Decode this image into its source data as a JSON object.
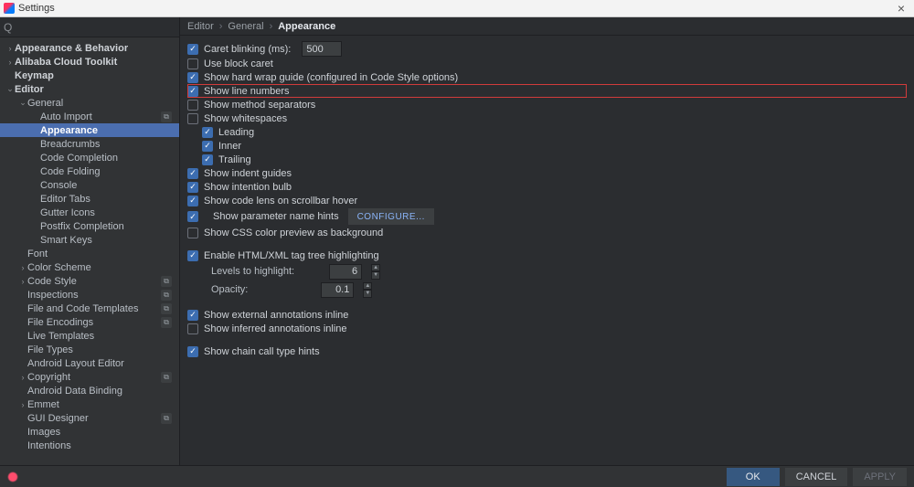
{
  "window": {
    "title": "Settings"
  },
  "search": {
    "placeholder": "",
    "value": ""
  },
  "sidebar": {
    "items": [
      {
        "depth": 0,
        "label": "Appearance & Behavior",
        "arrow": "›",
        "bold": true,
        "scope": false
      },
      {
        "depth": 0,
        "label": "Alibaba Cloud Toolkit",
        "arrow": "›",
        "bold": true,
        "scope": false
      },
      {
        "depth": 0,
        "label": "Keymap",
        "arrow": "",
        "bold": true,
        "scope": false
      },
      {
        "depth": 0,
        "label": "Editor",
        "arrow": "⌄",
        "bold": true,
        "scope": false
      },
      {
        "depth": 1,
        "label": "General",
        "arrow": "⌄",
        "bold": false,
        "scope": false
      },
      {
        "depth": 2,
        "label": "Auto Import",
        "arrow": "",
        "bold": false,
        "scope": true
      },
      {
        "depth": 2,
        "label": "Appearance",
        "arrow": "",
        "bold": false,
        "scope": false,
        "selected": true
      },
      {
        "depth": 2,
        "label": "Breadcrumbs",
        "arrow": "",
        "bold": false,
        "scope": false
      },
      {
        "depth": 2,
        "label": "Code Completion",
        "arrow": "",
        "bold": false,
        "scope": false
      },
      {
        "depth": 2,
        "label": "Code Folding",
        "arrow": "",
        "bold": false,
        "scope": false
      },
      {
        "depth": 2,
        "label": "Console",
        "arrow": "",
        "bold": false,
        "scope": false
      },
      {
        "depth": 2,
        "label": "Editor Tabs",
        "arrow": "",
        "bold": false,
        "scope": false
      },
      {
        "depth": 2,
        "label": "Gutter Icons",
        "arrow": "",
        "bold": false,
        "scope": false
      },
      {
        "depth": 2,
        "label": "Postfix Completion",
        "arrow": "",
        "bold": false,
        "scope": false
      },
      {
        "depth": 2,
        "label": "Smart Keys",
        "arrow": "",
        "bold": false,
        "scope": false
      },
      {
        "depth": 1,
        "label": "Font",
        "arrow": "",
        "bold": false,
        "scope": false
      },
      {
        "depth": 1,
        "label": "Color Scheme",
        "arrow": "›",
        "bold": false,
        "scope": false
      },
      {
        "depth": 1,
        "label": "Code Style",
        "arrow": "›",
        "bold": false,
        "scope": true
      },
      {
        "depth": 1,
        "label": "Inspections",
        "arrow": "",
        "bold": false,
        "scope": true
      },
      {
        "depth": 1,
        "label": "File and Code Templates",
        "arrow": "",
        "bold": false,
        "scope": true
      },
      {
        "depth": 1,
        "label": "File Encodings",
        "arrow": "",
        "bold": false,
        "scope": true
      },
      {
        "depth": 1,
        "label": "Live Templates",
        "arrow": "",
        "bold": false,
        "scope": false
      },
      {
        "depth": 1,
        "label": "File Types",
        "arrow": "",
        "bold": false,
        "scope": false
      },
      {
        "depth": 1,
        "label": "Android Layout Editor",
        "arrow": "",
        "bold": false,
        "scope": false
      },
      {
        "depth": 1,
        "label": "Copyright",
        "arrow": "›",
        "bold": false,
        "scope": true
      },
      {
        "depth": 1,
        "label": "Android Data Binding",
        "arrow": "",
        "bold": false,
        "scope": false
      },
      {
        "depth": 1,
        "label": "Emmet",
        "arrow": "›",
        "bold": false,
        "scope": false
      },
      {
        "depth": 1,
        "label": "GUI Designer",
        "arrow": "",
        "bold": false,
        "scope": true
      },
      {
        "depth": 1,
        "label": "Images",
        "arrow": "",
        "bold": false,
        "scope": false
      },
      {
        "depth": 1,
        "label": "Intentions",
        "arrow": "",
        "bold": false,
        "scope": false
      }
    ]
  },
  "breadcrumbs": {
    "a": "Editor",
    "b": "General",
    "c": "Appearance"
  },
  "options": {
    "caret_blinking": {
      "label": "Caret blinking (ms):",
      "value": "500",
      "checked": true
    },
    "use_block_caret": {
      "label": "Use block caret",
      "checked": false
    },
    "hard_wrap": {
      "label": "Show hard wrap guide (configured in Code Style options)",
      "checked": true
    },
    "line_numbers": {
      "label": "Show line numbers",
      "checked": true
    },
    "method_sep": {
      "label": "Show method separators",
      "checked": false
    },
    "whitespaces": {
      "label": "Show whitespaces",
      "checked": false
    },
    "ws_leading": {
      "label": "Leading",
      "checked": true
    },
    "ws_inner": {
      "label": "Inner",
      "checked": true
    },
    "ws_trailing": {
      "label": "Trailing",
      "checked": true
    },
    "indent_guides": {
      "label": "Show indent guides",
      "checked": true
    },
    "intention_bulb": {
      "label": "Show intention bulb",
      "checked": true
    },
    "code_lens": {
      "label": "Show code lens on scrollbar hover",
      "checked": true
    },
    "param_hints": {
      "label": "Show parameter name hints",
      "checked": true,
      "configure": "CONFIGURE..."
    },
    "css_color": {
      "label": "Show CSS color preview as background",
      "checked": false
    },
    "tag_tree": {
      "label": "Enable HTML/XML tag tree highlighting",
      "checked": true
    },
    "levels": {
      "label": "Levels to highlight:",
      "value": "6"
    },
    "opacity": {
      "label": "Opacity:",
      "value": "0.1"
    },
    "ext_annot": {
      "label": "Show external annotations inline",
      "checked": true
    },
    "inf_annot": {
      "label": "Show inferred annotations inline",
      "checked": false
    },
    "chain_hints": {
      "label": "Show chain call type hints",
      "checked": true
    }
  },
  "buttons": {
    "ok": "OK",
    "cancel": "CANCEL",
    "apply": "APPLY"
  }
}
